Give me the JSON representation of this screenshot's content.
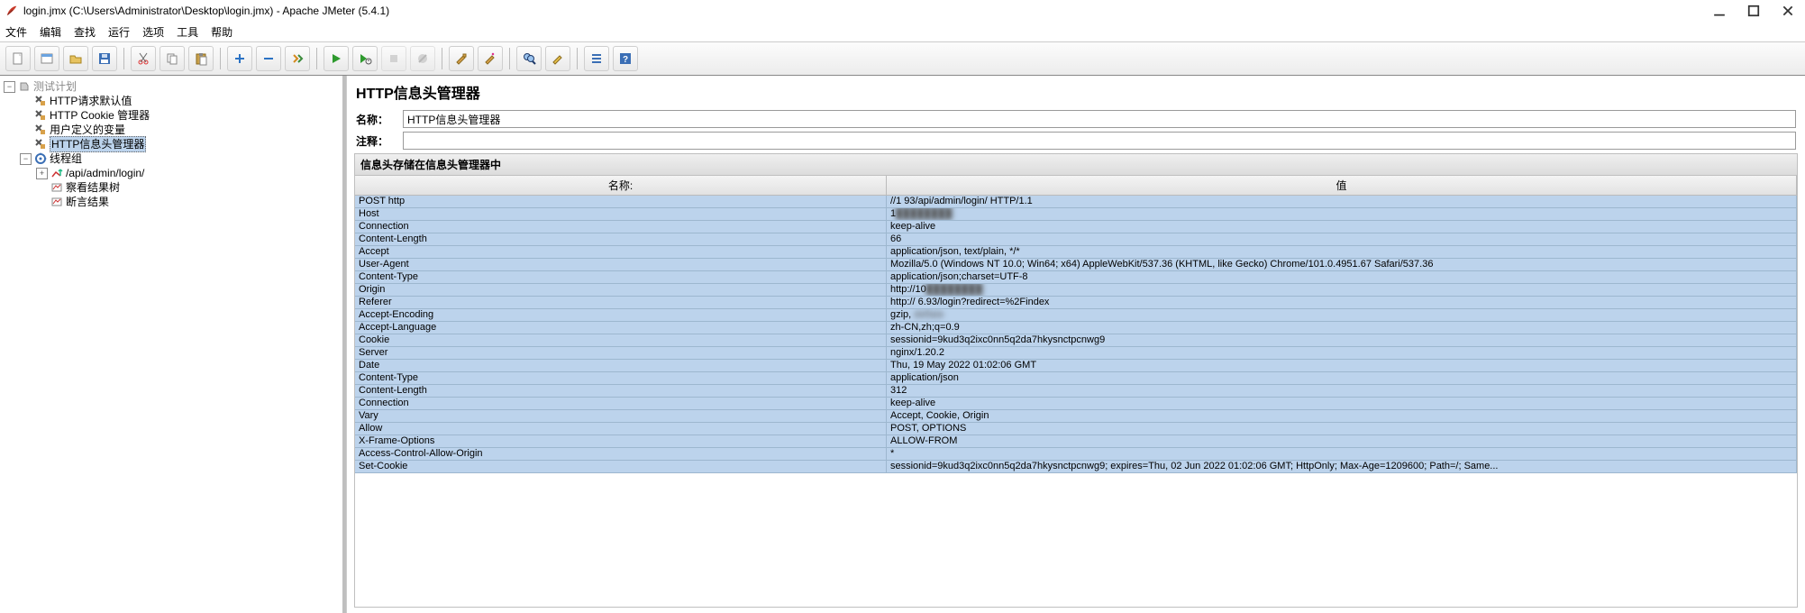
{
  "window": {
    "title": "login.jmx (C:\\Users\\Administrator\\Desktop\\login.jmx) - Apache JMeter (5.4.1)"
  },
  "menu": {
    "file": "文件",
    "edit": "编辑",
    "search": "查找",
    "run": "运行",
    "options": "选项",
    "tools": "工具",
    "help": "帮助"
  },
  "toolbar_icons": [
    "new-file-icon",
    "templates-icon",
    "open-icon",
    "save-icon",
    "cut-icon",
    "copy-icon",
    "paste-icon",
    "expand-icon",
    "collapse-icon",
    "toggle-icon",
    "start-icon",
    "start-no-pause-icon",
    "stop-icon",
    "shutdown-icon",
    "clear-icon",
    "clear-all-icon",
    "search-icon",
    "reset-search-icon",
    "function-helper-icon",
    "help-icon"
  ],
  "tree": {
    "root": "测试计划",
    "n1": "HTTP请求默认值",
    "n2": "HTTP Cookie 管理器",
    "n3": "用户定义的变量",
    "n4": "HTTP信息头管理器",
    "n5": "线程组",
    "n6": "/api/admin/login/",
    "n7": "察看结果树",
    "n8": "断言结果"
  },
  "panel": {
    "title": "HTTP信息头管理器",
    "name_label": "名称：",
    "name_value": "HTTP信息头管理器",
    "comment_label": "注释：",
    "comment_value": "",
    "section_header": "信息头存储在信息头管理器中",
    "col_name": "名称:",
    "col_value": "值"
  },
  "headers": [
    {
      "name": "POST http",
      "value": "//1            93/api/admin/login/ HTTP/1.1",
      "blur_start": 3,
      "blur_end": 14
    },
    {
      "name": "Host",
      "value": "1",
      "blur_tail": true
    },
    {
      "name": "Connection",
      "value": "keep-alive"
    },
    {
      "name": "Content-Length",
      "value": "66"
    },
    {
      "name": "Accept",
      "value": "application/json, text/plain, */*"
    },
    {
      "name": "User-Agent",
      "value": "Mozilla/5.0 (Windows NT 10.0; Win64; x64) AppleWebKit/537.36 (KHTML, like Gecko) Chrome/101.0.4951.67 Safari/537.36"
    },
    {
      "name": "Content-Type",
      "value": "application/json;charset=UTF-8"
    },
    {
      "name": "Origin",
      "value": "http://10",
      "blur_tail": true
    },
    {
      "name": "Referer",
      "value": "http://           6.93/login?redirect=%2Findex",
      "blur_start": 7,
      "blur_end": 18
    },
    {
      "name": "Accept-Encoding",
      "value": "gzip, deflate",
      "blur_start": 6,
      "blur_end": 13
    },
    {
      "name": "Accept-Language",
      "value": "zh-CN,zh;q=0.9"
    },
    {
      "name": "Cookie",
      "value": "sessionid=9kud3q2ixc0nn5q2da7hkysnctpcnwg9"
    },
    {
      "name": "Server",
      "value": "nginx/1.20.2"
    },
    {
      "name": "Date",
      "value": "Thu, 19 May 2022 01:02:06 GMT"
    },
    {
      "name": "Content-Type",
      "value": "application/json"
    },
    {
      "name": "Content-Length",
      "value": "312"
    },
    {
      "name": "Connection",
      "value": "keep-alive"
    },
    {
      "name": "Vary",
      "value": "Accept, Cookie, Origin"
    },
    {
      "name": "Allow",
      "value": "POST, OPTIONS"
    },
    {
      "name": "X-Frame-Options",
      "value": "ALLOW-FROM"
    },
    {
      "name": "Access-Control-Allow-Origin",
      "value": "*"
    },
    {
      "name": "Set-Cookie",
      "value": "sessionid=9kud3q2ixc0nn5q2da7hkysnctpcnwg9; expires=Thu, 02 Jun 2022 01:02:06 GMT; HttpOnly; Max-Age=1209600; Path=/; Same..."
    }
  ]
}
